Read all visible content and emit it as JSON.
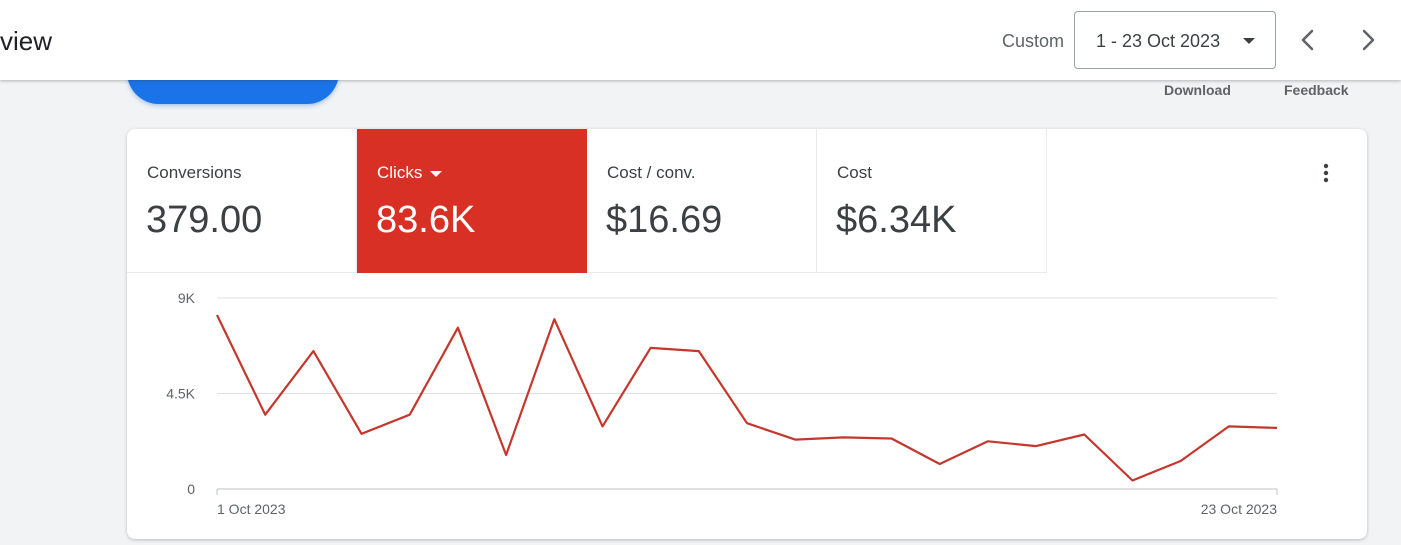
{
  "header": {
    "title": "view",
    "period_label": "Custom",
    "date_range": "1 - 23 Oct 2023"
  },
  "toolbar": {
    "download_label": "Download",
    "feedback_label": "Feedback"
  },
  "colors": {
    "accent_red": "#d93025",
    "primary_blue": "#1a73e8",
    "line": "#c5372c"
  },
  "icons": {
    "prev": "chevron-left-icon",
    "next": "chevron-right-icon",
    "more": "more-vert-icon",
    "date_caret": "caret-down-icon"
  },
  "metrics": [
    {
      "label": "Conversions",
      "value": "379.00",
      "active": false
    },
    {
      "label": "Clicks",
      "value": "83.6K",
      "active": true
    },
    {
      "label": "Cost / conv.",
      "value": "$16.69",
      "active": false
    },
    {
      "label": "Cost",
      "value": "$6.34K",
      "active": false
    }
  ],
  "chart_data": {
    "type": "line",
    "x": [
      "1 Oct 2023",
      "2 Oct 2023",
      "3 Oct 2023",
      "4 Oct 2023",
      "5 Oct 2023",
      "6 Oct 2023",
      "7 Oct 2023",
      "8 Oct 2023",
      "9 Oct 2023",
      "10 Oct 2023",
      "11 Oct 2023",
      "12 Oct 2023",
      "13 Oct 2023",
      "14 Oct 2023",
      "15 Oct 2023",
      "16 Oct 2023",
      "17 Oct 2023",
      "18 Oct 2023",
      "19 Oct 2023",
      "20 Oct 2023",
      "21 Oct 2023",
      "22 Oct 2023",
      "23 Oct 2023"
    ],
    "x_tick_labels": [
      "1 Oct 2023",
      "23 Oct 2023"
    ],
    "series": [
      {
        "values": [
          8200,
          3500,
          6500,
          2600,
          3500,
          7600,
          1600,
          8000,
          2950,
          6650,
          6500,
          3100,
          2330,
          2430,
          2380,
          1180,
          2250,
          2020,
          2570,
          400,
          1320,
          2950,
          2880
        ]
      }
    ],
    "y_ticks": [
      {
        "value": 0,
        "label": "0"
      },
      {
        "value": 4500,
        "label": "4.5K"
      },
      {
        "value": 9000,
        "label": "9K"
      }
    ],
    "ylim": [
      0,
      9000
    ],
    "grid": true,
    "title": "",
    "xlabel": "",
    "ylabel": ""
  }
}
